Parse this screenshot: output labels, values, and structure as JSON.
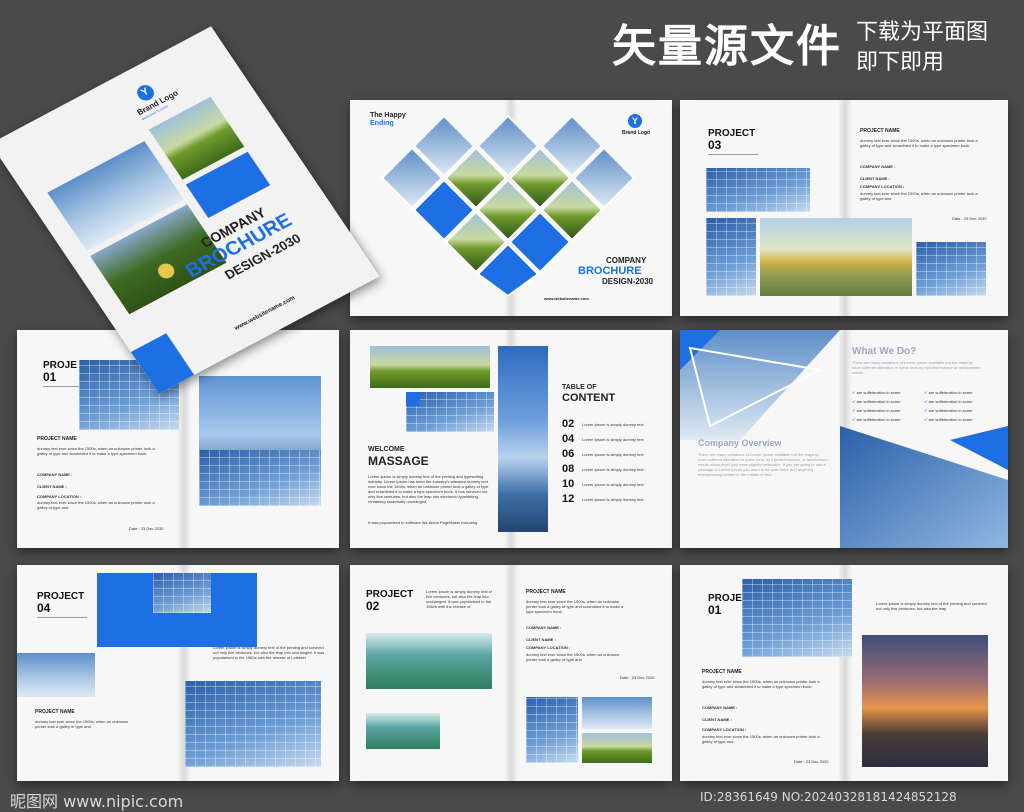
{
  "header": {
    "title": "矢量源文件",
    "sub1": "下载为平面图",
    "sub2": "即下即用"
  },
  "cover": {
    "brand": "Brand Logo",
    "brand_sub": "BRANDING SLOGAN",
    "company": "COMPANY",
    "brochure": "BROCHURE",
    "design": "DESIGN-2030",
    "website": "www.websitename.com"
  },
  "spread1": {
    "happy": "The Happy",
    "ending": "Ending",
    "brand": "Brand Logo",
    "company": "COMPANY",
    "brochure": "BROCHURE",
    "design": "DESIGN-2030",
    "website": "www.websitename.com"
  },
  "project03": {
    "title": "PROJECT",
    "num": "03",
    "name_label": "PROJECT NAME",
    "body": "dummy text ever since the 1500s, when an unknown printer took a galley of type and scrambled it to make a type specimen book.",
    "company_name": "COMPANY NAME :",
    "client_name": "CLIENT NAME :",
    "company_location": "COMPANY LOCATION :",
    "body2": "dummy text ever since the 1500s, when an unknown printer took a galley of type and",
    "date": "Date : 23 Dec 2030"
  },
  "project01a": {
    "title": "PROJE",
    "num": "01",
    "name_label": "PROJECT NAME",
    "body": "dummy text ever since the 1500s, when an unknown printer took a galley of type and scrambled it to make a type specimen book.",
    "company_name": "COMPANY NAME :",
    "client_name": "CLIENT NAME :",
    "company_location": "COMPANY LOCATION :",
    "body2": "dummy text ever since the 1500s, when an unknown printer took a galley of type and",
    "date": "Date : 23 Dec 2030"
  },
  "toc": {
    "welcome": "WELCOME",
    "massage": "MASSAGE",
    "body": "Lorem Ipsum is simply dummy text of the printing and typesetting industry. Lorem Ipsum has been the industry's standard dummy text ever since the 1500s, when an unknown printer took a galley of type and scrambled it to make a type specimen book. It has survived not only five centuries, but also the leap into electronic typesetting, remaining essentially unchanged.",
    "body2": "It was popularised in software like Aldus PageMaker including",
    "table": "TABLE OF",
    "content": "CONTENT",
    "entries": [
      {
        "n": "02",
        "t": "Lorem Ipsum is simply dummy text"
      },
      {
        "n": "04",
        "t": "Lorem Ipsum is simply dummy text"
      },
      {
        "n": "06",
        "t": "Lorem Ipsum is simply dummy text"
      },
      {
        "n": "08",
        "t": "Lorem Ipsum is simply dummy text"
      },
      {
        "n": "10",
        "t": "Lorem Ipsum is simply dummy text"
      },
      {
        "n": "12",
        "t": "Lorem Ipsum is simply dummy text"
      }
    ]
  },
  "overview": {
    "what": "What We Do?",
    "what_body": "There are many variations of Lorem Ipsum available but the majority have suffered alteration in some form by injected humour or randomised words.",
    "items": [
      "are suffeteration in some",
      "are suffeteration in some",
      "are suffeteration in some",
      "are suffeteration in some",
      "are suffeteration in some",
      "are suffeteration in some",
      "are suffeteration in some",
      "are suffeteration in some"
    ],
    "title": "Company Overview",
    "body": "There are many variations of Lorem Ipsum available but the majority have suffered alteration in some form, by injected humour, or randomised words which don't look even slightly believable. If you are going to use a passage of Lorem Ipsum you need to be sure there isn't anything embarrassing hidden in the middle of text."
  },
  "project04": {
    "title": "PROJECT",
    "num": "04",
    "body": "Lorem Ipsum is simply dummy text of the printing and survived not only five centuries, but also the leap into unchanged. It was popularised in the 1960s with the release of Letraset",
    "name_label": "PROJECT NAME",
    "body2": "dummy text ever since the 1500s, when an unknown printer took a galley of type and"
  },
  "project02": {
    "title": "PROJECT",
    "num": "02",
    "intro": "Lorem Ipsum is simply dummy text of five centuries, but also the leap into unchanged. It was popularised in the 1960s with the release of",
    "name_label": "PROJECT NAME",
    "body": "dummy text ever since the 1500s, when an unknown printer took a galley of type and scrambled it to make a type specimen book.",
    "company_name": "COMPANY NAME :",
    "client_name": "CLIENT NAME :",
    "company_location": "COMPANY LOCATION :",
    "body2": "dummy text ever since the 1500s, when an unknown printer took a galley of type and",
    "date": "Date : 23 Dec 2030"
  },
  "project01b": {
    "title": "PROJE",
    "num": "01",
    "intro": "Lorem Ipsum is simply dummy text of the printing and survived not only five centuries, but also the leap",
    "name_label": "PROJECT NAME",
    "body": "dummy text ever since the 1500s, when an unknown printer took a galley of type and scrambled it to make a type specimen book.",
    "company_name": "COMPANY NAME :",
    "client_name": "CLIENT NAME :",
    "company_location": "COMPANY LOCATION :",
    "body2": "dummy text ever since the 1500s, when an unknown printer took a galley of type and",
    "date": "Date : 23 Dec 2030"
  },
  "footer": {
    "left": "昵图网 www.nipic.com",
    "right": "ID:28361649 NO:20240328181424852128"
  },
  "colors": {
    "accent": "#1e6fe3",
    "background": "#4a4a4a"
  }
}
